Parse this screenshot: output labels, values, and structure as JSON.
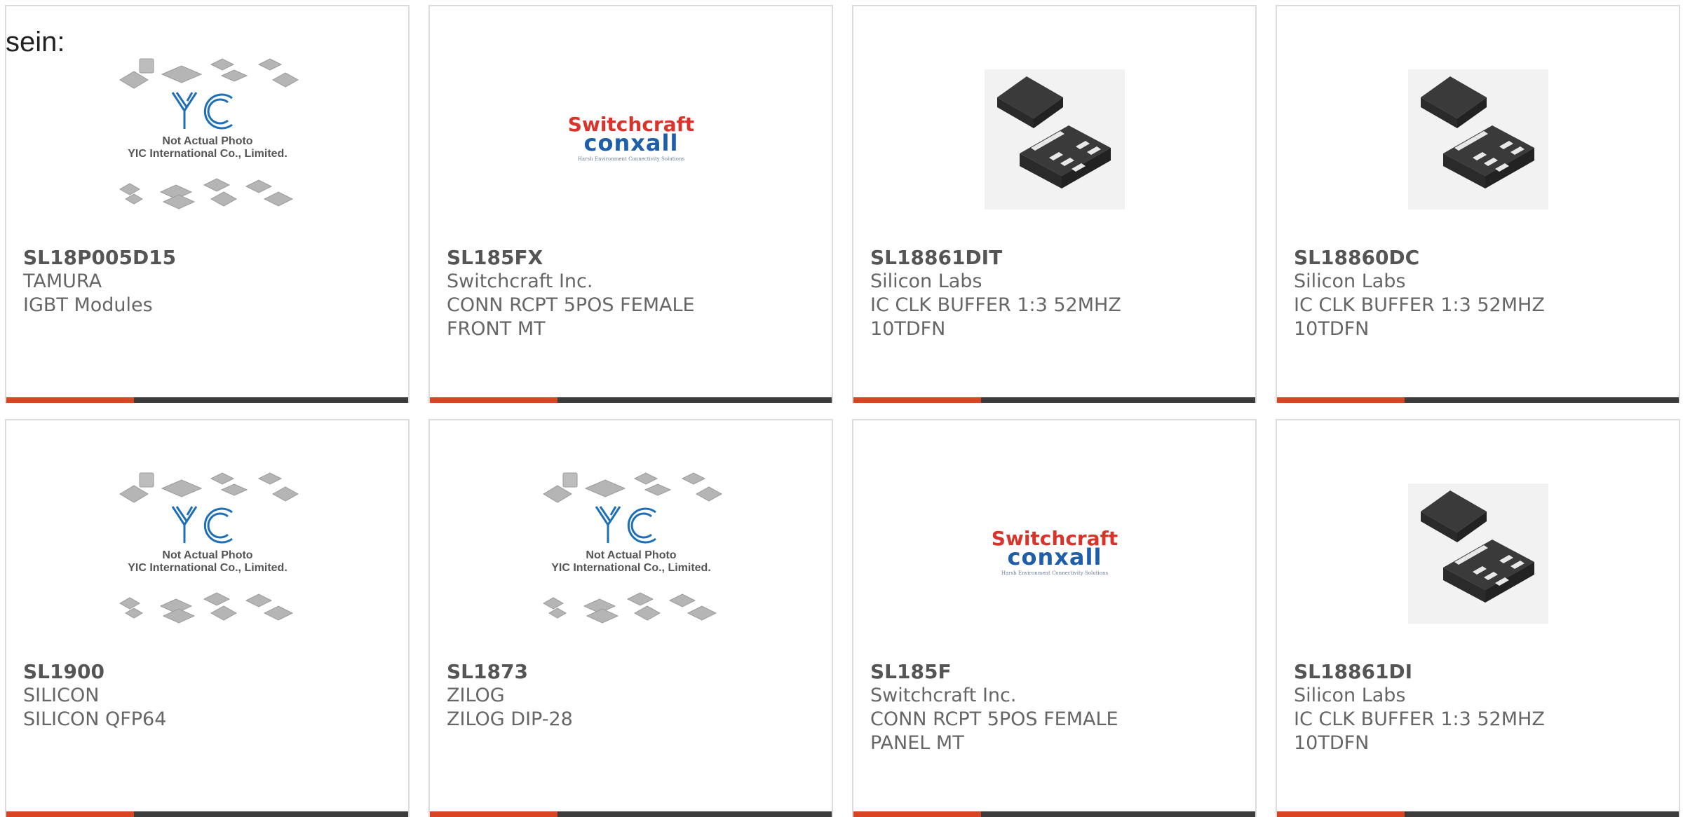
{
  "lead_text": "sein:",
  "colors": {
    "accent": "#d94522",
    "bar": "#3c3c3c",
    "border": "#dcdcdc"
  },
  "products": [
    {
      "part_number": "SL18P005D15",
      "manufacturer": "TAMURA",
      "description": "IGBT Modules",
      "image": "yic-placeholder",
      "image_text": {
        "line1": "Not Actual Photo",
        "line2": "YIC International Co., Limited."
      }
    },
    {
      "part_number": "SL185FX",
      "manufacturer": "Switchcraft Inc.",
      "description": "CONN RCPT 5POS FEMALE FRONT MT",
      "image": "switchcraft-logo",
      "image_text": {
        "line1": "Switchcraft",
        "line2": "conxall",
        "line3": "Harsh Environment Connectivity Solutions"
      }
    },
    {
      "part_number": "SL18861DIT",
      "manufacturer": "Silicon Labs",
      "description": "IC CLK BUFFER 1:3 52MHZ 10TDFN",
      "image": "tdfn-chip"
    },
    {
      "part_number": "SL18860DC",
      "manufacturer": "Silicon Labs",
      "description": "IC CLK BUFFER 1:3 52MHZ 10TDFN",
      "image": "tdfn-chip"
    },
    {
      "part_number": "SL1900",
      "manufacturer": "SILICON",
      "description": "SILICON QFP64",
      "image": "yic-placeholder",
      "image_text": {
        "line1": "Not Actual Photo",
        "line2": "YIC International Co., Limited."
      }
    },
    {
      "part_number": "SL1873",
      "manufacturer": "ZILOG",
      "description": "ZILOG DIP-28",
      "image": "yic-placeholder",
      "image_text": {
        "line1": "Not Actual Photo",
        "line2": "YIC International Co., Limited."
      }
    },
    {
      "part_number": "SL185F",
      "manufacturer": "Switchcraft Inc.",
      "description": "CONN RCPT 5POS FEMALE PANEL MT",
      "image": "switchcraft-logo",
      "image_text": {
        "line1": "Switchcraft",
        "line2": "conxall",
        "line3": "Harsh Environment Connectivity Solutions"
      }
    },
    {
      "part_number": "SL18861DI",
      "manufacturer": "Silicon Labs",
      "description": "IC CLK BUFFER 1:3 52MHZ 10TDFN",
      "image": "tdfn-chip"
    }
  ]
}
